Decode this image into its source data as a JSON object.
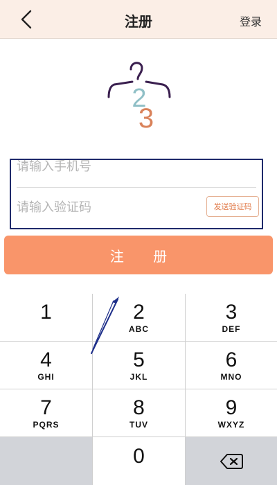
{
  "header": {
    "title": "注册",
    "login_label": "登录"
  },
  "form": {
    "phone_placeholder": "请输入手机号",
    "code_placeholder": "请输入验证码",
    "send_code_label": "发送验证码"
  },
  "register_label": "注 册",
  "keypad": {
    "keys": [
      {
        "num": "1",
        "letters": ""
      },
      {
        "num": "2",
        "letters": "ABC"
      },
      {
        "num": "3",
        "letters": "DEF"
      },
      {
        "num": "4",
        "letters": "GHI"
      },
      {
        "num": "5",
        "letters": "JKL"
      },
      {
        "num": "6",
        "letters": "MNO"
      },
      {
        "num": "7",
        "letters": "PQRS"
      },
      {
        "num": "8",
        "letters": "TUV"
      },
      {
        "num": "9",
        "letters": "WXYZ"
      },
      {
        "num": "",
        "letters": ""
      },
      {
        "num": "0",
        "letters": ""
      },
      {
        "num": "",
        "letters": ""
      }
    ]
  },
  "colors": {
    "header_bg": "#fbeee6",
    "accent": "#f9956a",
    "form_border": "#1f2a6b",
    "logo_dark": "#3a1f4f",
    "logo_teal": "#8fbfc6",
    "logo_orange": "#d9825a",
    "annotation": "#1e2f8a"
  },
  "icons": {
    "back": "chevron-left-icon",
    "logo": "hanger-logo-icon",
    "delete": "backspace-icon"
  }
}
